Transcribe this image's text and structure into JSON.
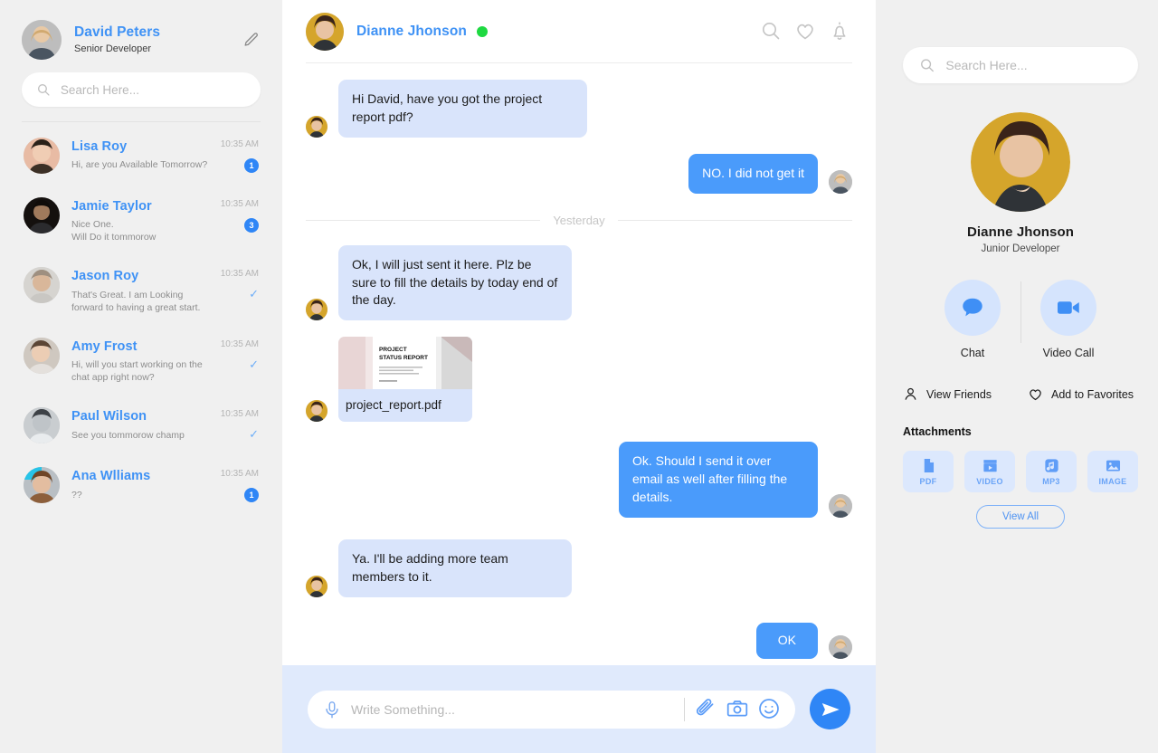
{
  "sidebar_left": {
    "profile": {
      "name": "David Peters",
      "role": "Senior Developer",
      "edit_icon": "pencil-icon"
    },
    "search": {
      "placeholder": "Search Here...",
      "value": "",
      "icon": "search-icon"
    },
    "contacts": [
      {
        "name": "Lisa Roy",
        "snippet": "Hi, are you Available Tomorrow?",
        "time": "10:35 AM",
        "badge": "1",
        "status": "unread"
      },
      {
        "name": "Jamie Taylor",
        "snippet": "Nice One.\nWill Do it tommorow",
        "time": "10:35 AM",
        "badge": "3",
        "status": "unread"
      },
      {
        "name": "Jason Roy",
        "snippet": "That's Great. I am Looking\nforward to having a great start.",
        "time": "10:35 AM",
        "badge": "✓",
        "status": "read"
      },
      {
        "name": "Amy Frost",
        "snippet": "Hi, will you start working on the\nchat app right now?",
        "time": "10:35 AM",
        "badge": "✓",
        "status": "read"
      },
      {
        "name": "Paul Wilson",
        "snippet": "See you tommorow champ",
        "time": "10:35 AM",
        "badge": "✓",
        "status": "read"
      },
      {
        "name": "Ana Wlliams",
        "snippet": "??",
        "time": "10:35 AM",
        "badge": "1",
        "status": "unread"
      }
    ]
  },
  "chat": {
    "header": {
      "name": "Dianne Jhonson",
      "presence": "online",
      "icons": [
        "search-icon",
        "heart-icon",
        "bell-icon"
      ]
    },
    "day_divider": "Yesterday",
    "messages": [
      {
        "dir": "in",
        "text": "Hi David, have you got the project report pdf?"
      },
      {
        "dir": "out",
        "text": "NO. I did not get it"
      },
      {
        "dir": "in",
        "text": "Ok, I will just sent it here. Plz be sure to fill the details by today end of the day."
      },
      {
        "dir": "in",
        "type": "file",
        "text": "project_report.pdf",
        "thumb_title": "PROJECT\nSTATUS REPORT"
      },
      {
        "dir": "out",
        "text": "Ok. Should I send it over email as well after filling the details."
      },
      {
        "dir": "in",
        "text": "Ya. I'll be adding more team members to it."
      },
      {
        "dir": "out",
        "text": "OK"
      }
    ],
    "composer": {
      "placeholder": "Write Something...",
      "value": "",
      "mic_icon": "microphone-icon",
      "icons": [
        "attachment-icon",
        "camera-icon",
        "emoji-icon"
      ],
      "send_icon": "send-icon"
    }
  },
  "sidebar_right": {
    "search": {
      "placeholder": "Search Here...",
      "value": "",
      "icon": "search-icon"
    },
    "profile": {
      "name": "Dianne Jhonson",
      "role": "Junior Developer"
    },
    "actions": [
      {
        "label": "Chat",
        "icon": "chat-bubble-icon"
      },
      {
        "label": "Video Call",
        "icon": "video-camera-icon"
      }
    ],
    "links": [
      {
        "label": "View Friends",
        "icon": "person-icon"
      },
      {
        "label": "Add to Favorites",
        "icon": "heart-icon"
      }
    ],
    "attachments": {
      "title": "Attachments",
      "chips": [
        {
          "label": "PDF",
          "icon": "file-icon"
        },
        {
          "label": "VIDEO",
          "icon": "clapperboard-icon"
        },
        {
          "label": "MP3",
          "icon": "music-note-icon"
        },
        {
          "label": "IMAGE",
          "icon": "image-icon"
        }
      ],
      "view_all_label": "View All"
    }
  },
  "colors": {
    "accent": "#2f86f6",
    "bubble_in": "#d9e4fb",
    "bubble_out": "#4a9bfb",
    "name_blue": "#3f92f5",
    "online": "#1ed941",
    "page_bg": "#f0f0f0",
    "composer_bg": "#e0eafc"
  }
}
